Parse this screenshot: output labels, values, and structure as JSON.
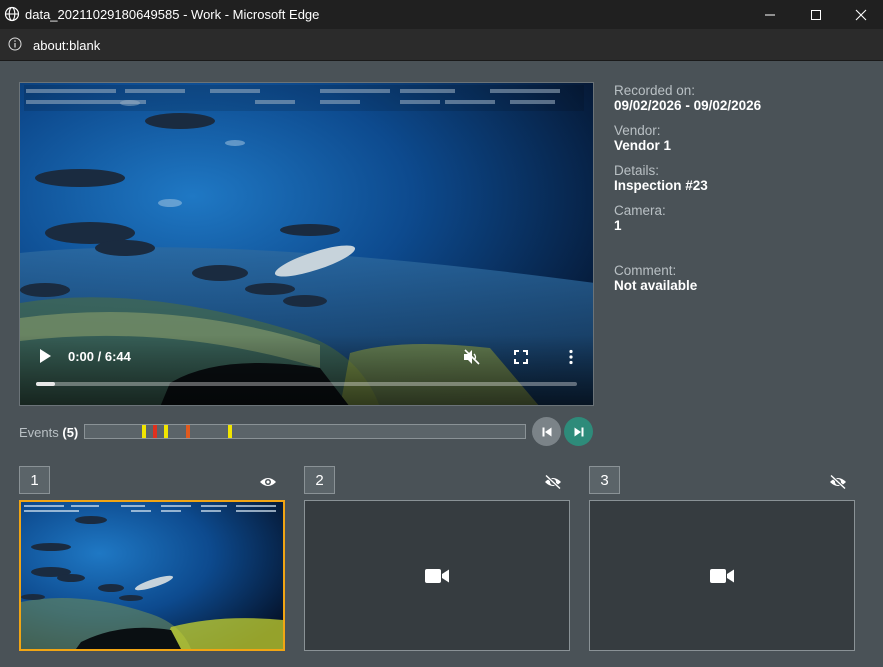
{
  "window": {
    "title": "data_20211029180649585 - Work - Microsoft Edge"
  },
  "address_bar": {
    "url": "about:blank"
  },
  "video": {
    "time": "0:00 / 6:44",
    "progress_fraction": 0.035
  },
  "metadata": {
    "recorded_on_label": "Recorded on:",
    "recorded_on": "09/02/2026 - 09/02/2026",
    "vendor_label": "Vendor:",
    "vendor": "Vendor 1",
    "details_label": "Details:",
    "details": "Inspection #23",
    "camera_label": "Camera:",
    "camera": "1",
    "comment_label": "Comment:",
    "comment": "Not available"
  },
  "events": {
    "label": "Events",
    "count": "(5)",
    "markers": [
      {
        "position_fraction": 0.13,
        "color": "#f2e600"
      },
      {
        "position_fraction": 0.155,
        "color": "#e0301e"
      },
      {
        "position_fraction": 0.18,
        "color": "#f2e600"
      },
      {
        "position_fraction": 0.23,
        "color": "#e05a1e"
      },
      {
        "position_fraction": 0.325,
        "color": "#f2e600"
      }
    ]
  },
  "cameras": [
    {
      "number": "1",
      "visibility_icon": "eye-icon",
      "active": true
    },
    {
      "number": "2",
      "visibility_icon": "eye-off-icon",
      "active": false
    },
    {
      "number": "3",
      "visibility_icon": "eye-off-icon",
      "active": false
    }
  ],
  "colors": {
    "accent_active": "#f1a514",
    "next_button": "#2e8b7a",
    "panel_bg": "#4a5257"
  }
}
